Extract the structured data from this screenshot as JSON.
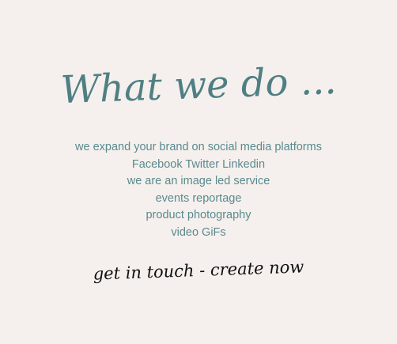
{
  "heading": "What we do ...",
  "services": [
    "we expand your brand on social media platforms",
    "Facebook Twitter Linkedin",
    "we are an image led service",
    "events reportage",
    "product photography",
    "video GiFs"
  ],
  "cta": "get in touch - create now",
  "colors": {
    "background": "#f5f0ed",
    "heading": "#4f7f83",
    "body_text": "#5a8a8e",
    "cta": "#111111"
  }
}
